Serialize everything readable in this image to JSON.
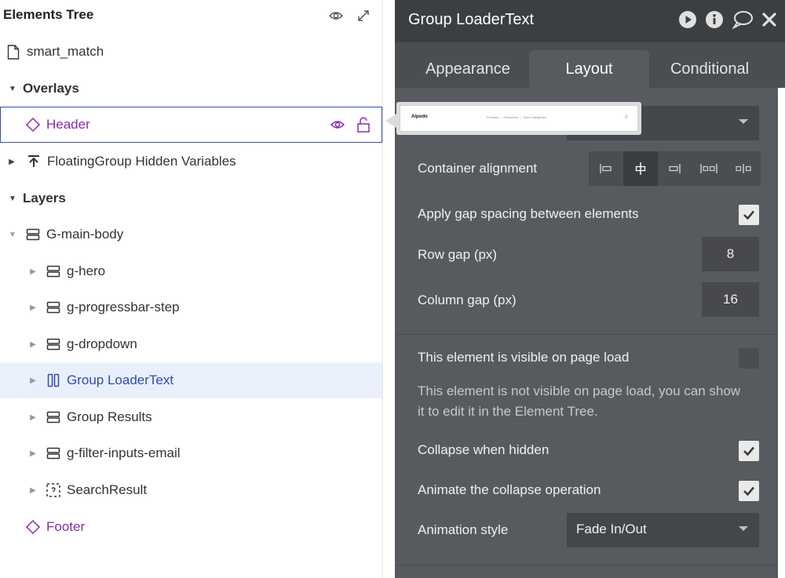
{
  "tree": {
    "title": "Elements Tree",
    "rows": [
      {
        "label": "smart_match",
        "icon": "page-icon"
      },
      {
        "label": "Overlays",
        "icon": ""
      },
      {
        "label": "Header",
        "icon": "reusable-diamond-icon"
      },
      {
        "label": "FloatingGroup Hidden Variables",
        "icon": "floating-group-icon"
      },
      {
        "label": "Layers",
        "icon": ""
      },
      {
        "label": "G-main-body",
        "icon": "group-column-icon"
      },
      {
        "label": "g-hero",
        "icon": "group-column-icon"
      },
      {
        "label": "g-progressbar-step",
        "icon": "group-column-icon"
      },
      {
        "label": "g-dropdown",
        "icon": "group-column-icon"
      },
      {
        "label": "Group LoaderText",
        "icon": "group-row-icon"
      },
      {
        "label": "Group Results",
        "icon": "group-column-icon"
      },
      {
        "label": "g-filter-inputs-email",
        "icon": "group-column-icon"
      },
      {
        "label": "SearchResult",
        "icon": "dashed-group-icon"
      },
      {
        "label": "Footer",
        "icon": "reusable-diamond-icon"
      }
    ]
  },
  "preview": {
    "logo": "Alpodo",
    "nav": "Products ⌄   Resources ⌄   Tools   Categories",
    "search": "⚲"
  },
  "panel": {
    "title": "Group LoaderText",
    "tabs": [
      "Appearance",
      "Layout",
      "Conditional"
    ],
    "active_tab": "Layout",
    "container_alignment_label": "Container alignment",
    "gap_label": "Apply gap spacing between elements",
    "gap_checked": true,
    "row_gap_label": "Row gap (px)",
    "row_gap_value": "8",
    "column_gap_label": "Column gap (px)",
    "column_gap_value": "16",
    "visible_label": "This element is visible on page load",
    "visible_checked": false,
    "visible_help": "This element is not visible on page load, you can show it to edit it in the Element Tree.",
    "collapse_label": "Collapse when hidden",
    "collapse_checked": true,
    "animate_label": "Animate the collapse operation",
    "animate_checked": true,
    "animation_style_label": "Animation style",
    "animation_style_value": "Fade In/Out"
  }
}
